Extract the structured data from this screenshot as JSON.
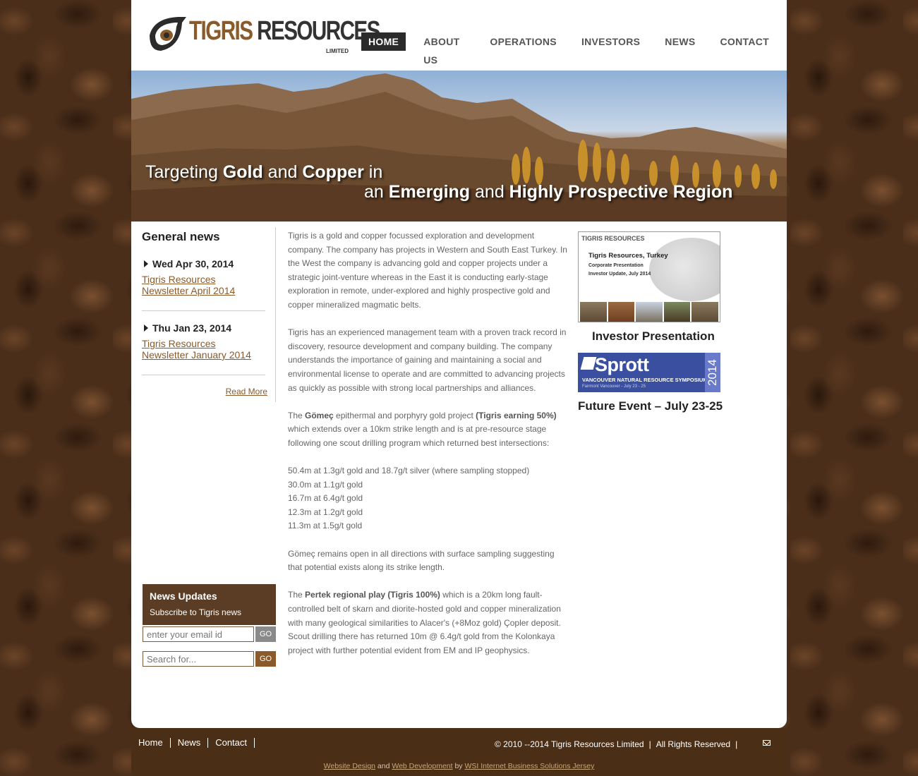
{
  "header": {
    "logo_word1": "TIGRIS",
    "logo_word2": "RESOURCES",
    "logo_sub": "LIMITED",
    "nav": [
      {
        "label": "HOME",
        "active": true
      },
      {
        "label": "ABOUT US"
      },
      {
        "label": "OPERATIONS"
      },
      {
        "label": "INVESTORS"
      },
      {
        "label": "NEWS"
      },
      {
        "label": "CONTACT"
      }
    ]
  },
  "banner": {
    "line1_a": "Targeting ",
    "line1_b": "Gold",
    "line1_c": " and ",
    "line1_d": "Copper",
    "line1_e": " in",
    "line2_a": "an ",
    "line2_b": "Emerging",
    "line2_c": " and ",
    "line2_d": "Highly Prospective Region"
  },
  "general_news": {
    "title": "General news",
    "items": [
      {
        "date": "Wed Apr 30, 2014",
        "link_line1": "Tigris Resources",
        "link_line2": "Newsletter April 2014"
      },
      {
        "date": "Thu Jan 23, 2014",
        "link_line1": "Tigris Resources",
        "link_line2": "Newsletter January 2014"
      }
    ],
    "read_more": "Read More"
  },
  "subscribe": {
    "title": "News Updates",
    "text": "Subscribe to Tigris news",
    "email_placeholder": "enter your email id",
    "search_placeholder": "Search for...",
    "go_label": "GO"
  },
  "main": {
    "p1": "Tigris is a gold and copper focussed exploration and development company. The company has projects in Western and South East Turkey. In the West the company is advancing gold and copper projects under a strategic joint-venture whereas in the East it is conducting early-stage exploration in remote, under-explored and highly prospective gold and copper mineralized magmatic belts.",
    "p2": "Tigris has an experienced management team with a proven track record in discovery, resource development and company building. The company understands the importance of gaining and maintaining a social and environmental license to operate and are committed to advancing projects as quickly as possible with strong local partnerships and alliances.",
    "p3_a": "The ",
    "p3_b": "Gömeç",
    "p3_c": " epithermal and porphyry gold project ",
    "p3_d": "(Tigris earning 50%)",
    "p3_e": " which extends over a 10km strike length and is at pre-resource stage following one scout drilling program which returned best intersections:",
    "intersections": [
      "50.4m at 1.3g/t gold and 18.7g/t silver (where sampling stopped)",
      "30.0m at 1.1g/t gold",
      "16.7m at 6.4g/t gold",
      "12.3m at 1.2g/t gold",
      "11.3m at 1.5g/t gold"
    ],
    "p4": "Gömeç remains open in all directions with surface sampling suggesting that potential exists along its strike length.",
    "p5_a": "The ",
    "p5_b": "Pertek regional play (Tigris 100%)",
    "p5_c": " which is a 20km long fault-controlled belt of skarn and diorite-hosted gold and copper mineralization with many geological similarities to Alacer's (+8Moz gold) Çopler deposit. Scout drilling there has returned 10m @ 6.4g/t gold from the Kolonkaya project with further potential evident from EM and IP geophysics."
  },
  "right": {
    "thumb_logo": "TIGRIS RESOURCES",
    "thumb_title": "Tigris Resources, Turkey",
    "thumb_sub1": "Corporate Presentation",
    "thumb_sub2": "Investor Update, July 2014",
    "invest_caption": "Investor Presentation",
    "sprott_logo": "Sprott",
    "sprott_line1": "VANCOUVER NATURAL RESOURCE SYMPOSIUM",
    "sprott_line2": "Fairmont Vancouver - July 23 - 25",
    "sprott_year": "2014",
    "future_caption": "Future Event – July 23-25"
  },
  "footer": {
    "links": [
      "Home",
      "News",
      "Contact"
    ],
    "copyright": "© 2010 --2014 Tigris Resources Limited",
    "rights": "All Rights Reserved",
    "sep": "|",
    "credit_link1": "Website Design",
    "credit_and": " and ",
    "credit_link2": "Web Development",
    "credit_by": " by ",
    "credit_link3": "WSI Internet Business Solutions Jersey"
  },
  "colors": {
    "accent_brown": "#8a5a2b",
    "footer_bg": "#4a2e16",
    "nav_active_bg": "#2b2b2b"
  }
}
